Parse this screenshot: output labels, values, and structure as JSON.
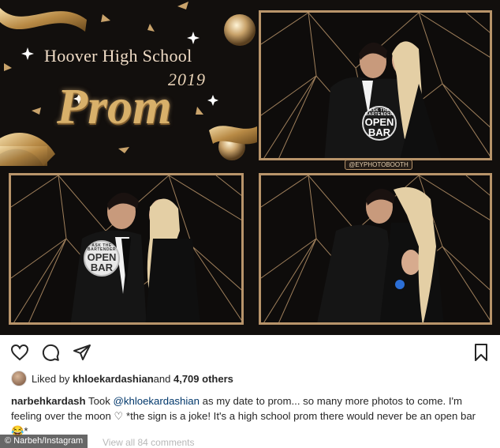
{
  "flyer": {
    "school_name": "Hoover High School",
    "year": "2019",
    "event": "Prom",
    "booth_tag": "@EYPHOTOBOOTH",
    "sign_small_text": "ASK THE BARTENDER",
    "sign_text_line1": "OPEN",
    "sign_text_line2": "BAR"
  },
  "actions": {
    "like_icon": "heart-icon",
    "comment_icon": "comment-icon",
    "share_icon": "paper-plane-icon",
    "save_icon": "bookmark-icon"
  },
  "likes": {
    "prefix": "Liked by ",
    "user": "khloekardashian",
    "middle": " and ",
    "count": "4,709 others"
  },
  "caption": {
    "username": "narbehkardash",
    "text_before": " Took ",
    "mention": "@khloekardashian",
    "text_after": " as my date to prom... so many more photos to come. I'm feeling over the moon ♡ *the sign is a joke! It's a high school prom there would never be an open bar 😂*"
  },
  "credit": "© Narbeh/Instagram",
  "view_all": "View all 84 comments",
  "colors": {
    "gold": "#c9a36b",
    "link": "#00376b",
    "text": "#262626"
  }
}
